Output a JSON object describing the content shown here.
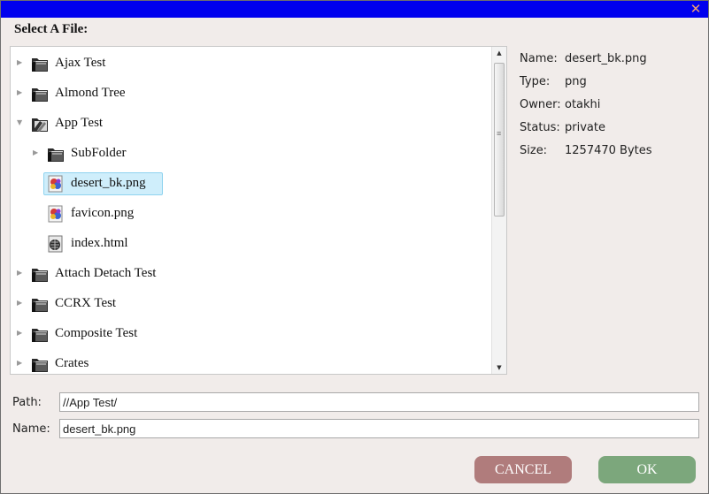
{
  "dialog": {
    "close_glyph": "✕",
    "heading": "Select A File:"
  },
  "tree": {
    "rows": [
      {
        "label": "Ajax Test",
        "type": "folder",
        "depth": 0,
        "expanded": false
      },
      {
        "label": "Almond Tree",
        "type": "folder",
        "depth": 0,
        "expanded": false
      },
      {
        "label": "App Test",
        "type": "app-folder",
        "depth": 0,
        "expanded": true
      },
      {
        "label": "SubFolder",
        "type": "folder",
        "depth": 1,
        "expanded": false
      },
      {
        "label": "desert_bk.png",
        "type": "image-file",
        "depth": 1,
        "selected": true
      },
      {
        "label": "favicon.png",
        "type": "image-file",
        "depth": 1
      },
      {
        "label": "index.html",
        "type": "html-file",
        "depth": 1
      },
      {
        "label": "Attach Detach Test",
        "type": "folder",
        "depth": 0,
        "expanded": false
      },
      {
        "label": "CCRX Test",
        "type": "folder",
        "depth": 0,
        "expanded": false
      },
      {
        "label": "Composite Test",
        "type": "folder",
        "depth": 0,
        "expanded": false
      },
      {
        "label": "Crates",
        "type": "folder",
        "depth": 0,
        "expanded": false
      }
    ],
    "icons": {
      "collapsed": "▶",
      "expanded": "▼"
    }
  },
  "info": {
    "name_label": "Name:",
    "name_value": "desert_bk.png",
    "type_label": "Type:",
    "type_value": "png",
    "owner_label": "Owner:",
    "owner_value": "otakhi",
    "status_label": "Status:",
    "status_value": "private",
    "size_label": "Size:",
    "size_value": "1257470 Bytes"
  },
  "fields": {
    "path_label": "Path:",
    "path_value": "//App Test/",
    "name_label": "Name:",
    "name_value": "desert_bk.png"
  },
  "buttons": {
    "cancel": "CANCEL",
    "ok": "OK"
  },
  "colors": {
    "titlebar": "#0000ee",
    "cancel": "#b07c7c",
    "ok": "#7ca77c",
    "selection": "#cfeefb"
  }
}
